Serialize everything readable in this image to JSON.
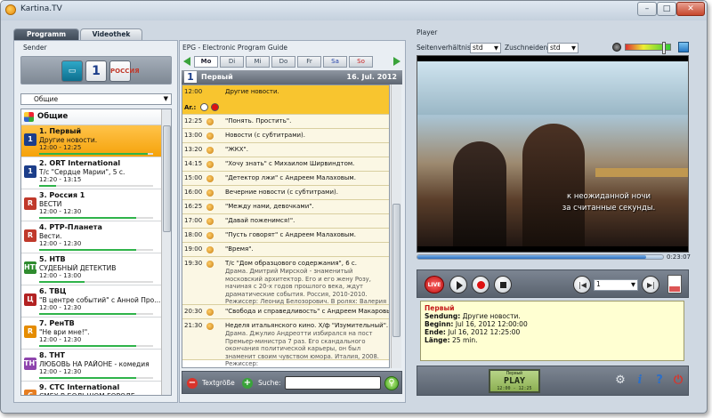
{
  "window": {
    "title": "Kartina.TV"
  },
  "tabs": [
    {
      "label": "Programm"
    },
    {
      "label": "Videothek"
    }
  ],
  "sender": {
    "heading": "Sender",
    "group_select": "Общие",
    "group_label": "Общие",
    "channels": [
      {
        "name": "1. Первый",
        "show": "Другие новости.",
        "time": "12:00 - 12:25",
        "progress": 0.95,
        "logo": "1",
        "logo_color": "#1c3e8a",
        "selected": true
      },
      {
        "name": "2. ORT International",
        "show": "Т/с \"Сердце Марии\", 5 с.",
        "time": "12:20 - 13:15",
        "progress": 0.15,
        "logo": "1",
        "logo_color": "#1c3e8a"
      },
      {
        "name": "3. Россия 1",
        "show": "ВЕСТИ",
        "time": "12:00 - 12:30",
        "progress": 0.85,
        "logo": "R",
        "logo_color": "#c0392b"
      },
      {
        "name": "4. РТР-Планета",
        "show": "Вести.",
        "time": "12:00 - 12:30",
        "progress": 0.85,
        "logo": "R",
        "logo_color": "#c0392b"
      },
      {
        "name": "5. НТВ",
        "show": "СУДЕБНЫЙ ДЕТЕКТИВ",
        "time": "12:00 - 13:00",
        "progress": 0.4,
        "logo": "НТВ",
        "logo_color": "#2e8b2e"
      },
      {
        "name": "6. ТВЦ",
        "show": "\"В центре событий\" с Анной Про...",
        "time": "12:00 - 12:30",
        "progress": 0.85,
        "logo": "Ц",
        "logo_color": "#b22222"
      },
      {
        "name": "7. РенТВ",
        "show": "\"Не ври мне!\".",
        "time": "12:00 - 12:30",
        "progress": 0.85,
        "logo": "R",
        "logo_color": "#e58c00"
      },
      {
        "name": "8. ТНТ",
        "show": "ЛЮБОВЬ НА РАЙОНЕ - комедия",
        "time": "12:00 - 12:30",
        "progress": 0.85,
        "logo": "ТНТ",
        "logo_color": "#8e44ad"
      },
      {
        "name": "9. CTC International",
        "show": "СМЕХ В БОЛЬШОМ ГОРОДЕ",
        "time": "",
        "progress": 0.5,
        "logo": "C",
        "logo_color": "#e67e22"
      }
    ]
  },
  "epg": {
    "heading": "EPG - Electronic Program Guide",
    "days": [
      "Mo",
      "Di",
      "Mi",
      "Do",
      "Fr",
      "Sa",
      "So"
    ],
    "channel": "Первый",
    "date": "16. Jul. 2012",
    "current_label": "Ar.:",
    "entries": [
      {
        "time": "12:00",
        "title": "Другие новости.",
        "current": true
      },
      {
        "time": "12:25",
        "title": "\"Понять. Простить\"."
      },
      {
        "time": "13:00",
        "title": "Новости (с субтитрами)."
      },
      {
        "time": "13:20",
        "title": "\"ЖКХ\"."
      },
      {
        "time": "14:15",
        "title": "\"Хочу знать\" с Михаилом Ширвиндтом."
      },
      {
        "time": "15:00",
        "title": "\"Детектор лжи\" с Андреем Малаховым."
      },
      {
        "time": "16:00",
        "title": "Вечерние новости (с субтитрами)."
      },
      {
        "time": "16:25",
        "title": "\"Между нами, девочками\"."
      },
      {
        "time": "17:00",
        "title": "\"Давай поженимся!\"."
      },
      {
        "time": "18:00",
        "title": "\"Пусть говорят\" с Андреем Малаховым."
      },
      {
        "time": "19:00",
        "title": "\"Время\"."
      },
      {
        "time": "19:30",
        "title": "Т/с \"Дом образцового содержания\", 6 с.",
        "desc": "Драма. Дмитрий Мирской - знаменитый московский архитектор. Его и его жену Розу, начиная с 20-х годов прошлого века, ждут драматические события. Россия, 2010-2010. Режиссер: Леонид Белозорович. В ролях: Валерия Ланская, Анна Алексахина, Андрей Смоляков."
      },
      {
        "time": "20:30",
        "title": "\"Свобода и справедливость\" с Андреем Макаровым."
      },
      {
        "time": "21:30",
        "title": "Неделя итальянского кино. Х/ф \"Изумительный\".",
        "desc": "Драма. Джулио Андреотти избирался на пост Премьер-министра 7 раз. Его скандального окончания политической карьеры, он был знаменит своим чувством юмора. Италия, 2008. Режиссер:"
      }
    ],
    "footer": {
      "textsize_label": "Textgröße",
      "search_label": "Suche:",
      "search_value": ""
    }
  },
  "player": {
    "heading": "Player",
    "aspect_label": "Seitenverhältnis:",
    "aspect_value": "std",
    "crop_label": "Zuschneiden:",
    "crop_value": "std",
    "subtitle_line1": "к неожиданной ночи",
    "subtitle_line2": "за считанные секунды.",
    "duration": "0:23:07",
    "seek_progress": 0.93,
    "volume_level": 0.85,
    "live_label": "LIVE",
    "channel_select": "1",
    "info": {
      "channel": "Первый",
      "sendung_label": "Sendung:",
      "sendung": "Другие новости.",
      "beginn_label": "Beginn:",
      "beginn": "Jul 16, 2012 12:00:00",
      "ende_label": "Ende:",
      "ende": "Jul 16, 2012 12:25:00",
      "laenge_label": "Länge:",
      "laenge": "25 min."
    },
    "lcd": {
      "top": "Первый",
      "main": "PLAY",
      "bottom": "12:00 - 12:25"
    }
  },
  "colors": {
    "accent": "#f5a20a",
    "progress": "#2fb34a",
    "lcd": "#a6c46c"
  }
}
